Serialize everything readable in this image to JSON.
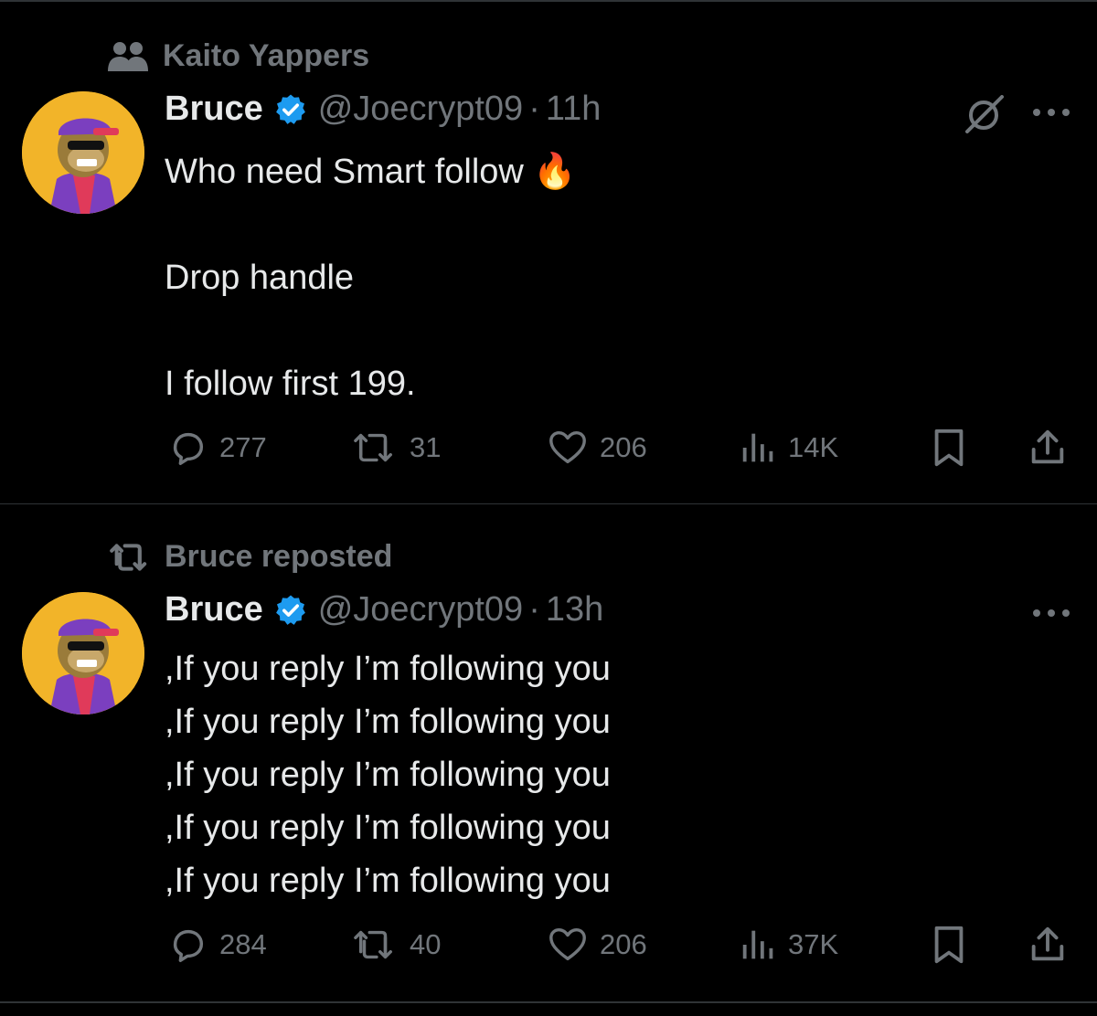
{
  "colors": {
    "background": "#000000",
    "text": "#e7e9ea",
    "muted": "#71767b",
    "verified": "#1d9bf0",
    "divider": "#2f3336"
  },
  "tweets": [
    {
      "context": {
        "icon": "community-icon",
        "text": "Kaito Yappers"
      },
      "name": "Bruce",
      "handle": "@Joecrypt09",
      "separator": "·",
      "time": "11h",
      "has_grok_icon": true,
      "text_lines": [
        "Who need Smart follow 🔥",
        "",
        "Drop handle",
        "",
        "I follow first 199."
      ],
      "stats": {
        "replies": "277",
        "reposts": "31",
        "likes": "206",
        "views": "14K"
      }
    },
    {
      "context": {
        "icon": "repost-icon",
        "text": "Bruce reposted"
      },
      "name": "Bruce",
      "handle": "@Joecrypt09",
      "separator": "·",
      "time": "13h",
      "has_grok_icon": false,
      "text_lines": [
        ",If you reply I’m following you",
        ",If you reply I’m following you",
        ",If you reply I’m following you",
        ",If you reply I’m following you",
        ",If you reply I’m following you"
      ],
      "stats": {
        "replies": "284",
        "reposts": "40",
        "likes": "206",
        "views": "37K"
      }
    }
  ]
}
